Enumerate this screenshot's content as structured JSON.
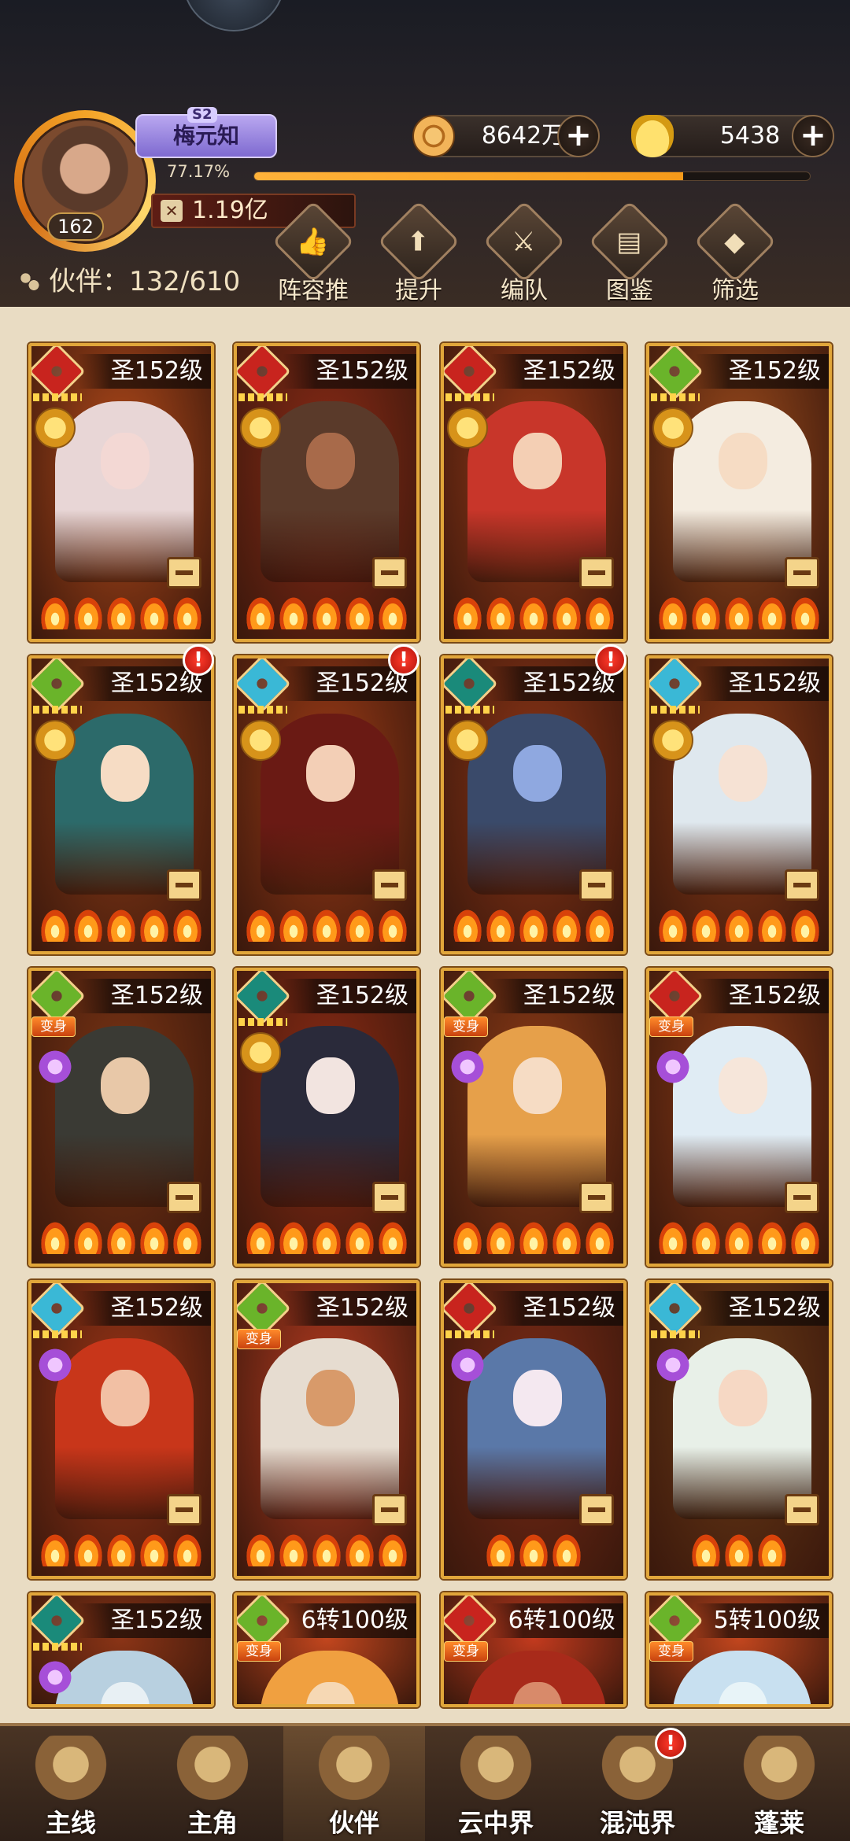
{
  "player": {
    "name": "梅元知",
    "server": "S2",
    "level": "162",
    "exp_percent_text": "77.17%",
    "exp_fraction": 0.7717,
    "power": "1.19亿",
    "power_icon": "crossed-swords-icon"
  },
  "currency": {
    "coins": "8642万",
    "gold": "5438"
  },
  "partners": {
    "label": "伙伴：132/610"
  },
  "toolbar": [
    {
      "label": "阵容推荐",
      "icon": "thumbs-up-icon"
    },
    {
      "label": "提升",
      "icon": "upgrade-arrow-icon"
    },
    {
      "label": "编队",
      "icon": "formation-icon"
    },
    {
      "label": "图鉴",
      "icon": "scroll-icon"
    },
    {
      "label": "筛选",
      "icon": "filter-icon"
    }
  ],
  "cards": [
    {
      "level": "圣152级",
      "element": "red",
      "sub": "gold",
      "stars": 5,
      "alert": false,
      "transform": "",
      "bg": "#b34a1a",
      "char": "#e8d6d6",
      "face": "#f3d8d4"
    },
    {
      "level": "圣152级",
      "element": "red",
      "sub": "gold",
      "stars": 5,
      "alert": false,
      "transform": "",
      "bg": "#8a2a16",
      "char": "#5a3a2a",
      "face": "#a86a4a"
    },
    {
      "level": "圣152级",
      "element": "red",
      "sub": "gold",
      "stars": 5,
      "alert": false,
      "transform": "",
      "bg": "#9a3a18",
      "char": "#c8362a",
      "face": "#f4cfb4"
    },
    {
      "level": "圣152级",
      "element": "green",
      "sub": "gold",
      "stars": 5,
      "alert": false,
      "transform": "",
      "bg": "#9a4a1c",
      "char": "#f4ece0",
      "face": "#f6dcc4"
    },
    {
      "level": "圣152级",
      "element": "green",
      "sub": "gold",
      "stars": 5,
      "alert": true,
      "transform": "",
      "bg": "#8a3a16",
      "char": "#2c6a6a",
      "face": "#f6dcc4"
    },
    {
      "level": "圣152级",
      "element": "cyan",
      "sub": "gold",
      "stars": 5,
      "alert": true,
      "transform": "",
      "bg": "#9a3a16",
      "char": "#6a1a14",
      "face": "#f3cfb6"
    },
    {
      "level": "圣152级",
      "element": "teal",
      "sub": "gold",
      "stars": 5,
      "alert": true,
      "transform": "",
      "bg": "#8a3416",
      "char": "#3a4a6a",
      "face": "#8fa8e0"
    },
    {
      "level": "圣152级",
      "element": "cyan",
      "sub": "gold",
      "stars": 5,
      "alert": false,
      "transform": "",
      "bg": "#8a3a16",
      "char": "#dfe8ee",
      "face": "#f6e2d4"
    },
    {
      "level": "圣152级",
      "element": "green",
      "sub": "purple",
      "stars": 5,
      "alert": false,
      "transform": "变身",
      "bg": "#7a3414",
      "char": "#3a3a34",
      "face": "#e8c8a8"
    },
    {
      "level": "圣152级",
      "element": "teal",
      "sub": "moon",
      "stars": 5,
      "alert": false,
      "transform": "",
      "bg": "#8a2a14",
      "char": "#2a2a3a",
      "face": "#f2e4e0"
    },
    {
      "level": "圣152级",
      "element": "green",
      "sub": "purple",
      "stars": 5,
      "alert": false,
      "transform": "变身",
      "bg": "#8a3a16",
      "char": "#e6a04a",
      "face": "#f6dcc4"
    },
    {
      "level": "圣152级",
      "element": "red",
      "sub": "purple",
      "stars": 5,
      "alert": false,
      "transform": "变身",
      "bg": "#8a3a16",
      "char": "#e0ecf4",
      "face": "#f6e6da"
    },
    {
      "level": "圣152级",
      "element": "cyan",
      "sub": "purple",
      "stars": 5,
      "alert": false,
      "transform": "",
      "bg": "#9a3416",
      "char": "#c8361a",
      "face": "#f2c0a4"
    },
    {
      "level": "圣152级",
      "element": "green",
      "sub": "none",
      "stars": 0,
      "alert": false,
      "transform": "变身",
      "bg": "#b43a20",
      "char": "#e6dcd0",
      "face": "#d89a6a"
    },
    {
      "level": "圣152级",
      "element": "red",
      "sub": "purple",
      "stars": 3,
      "alert": false,
      "transform": "",
      "bg": "#7a2a16",
      "char": "#5a78a8",
      "face": "#f4e8f0"
    },
    {
      "level": "圣152级",
      "element": "cyan",
      "sub": "purple",
      "stars": 3,
      "alert": false,
      "transform": "",
      "bg": "#6a3a16",
      "char": "#e8f0e8",
      "face": "#f6d8c4"
    },
    {
      "level": "圣152级",
      "element": "teal",
      "sub": "purple",
      "stars": 0,
      "alert": false,
      "transform": "",
      "bg": "#8a3416",
      "char": "#b8d0e0",
      "face": "#e8f0f4"
    },
    {
      "level": "6转100级",
      "element": "green",
      "sub": "none",
      "stars": 0,
      "alert": false,
      "transform": "变身",
      "bg": "#c2461e",
      "char": "#f0a040",
      "face": "#f6d8b4"
    },
    {
      "level": "6转100级",
      "element": "red",
      "sub": "none",
      "stars": 0,
      "alert": false,
      "transform": "变身",
      "bg": "#c23a1e",
      "char": "#a82a1a",
      "face": "#d88a6a"
    },
    {
      "level": "5转100级",
      "element": "green",
      "sub": "none",
      "stars": 0,
      "alert": false,
      "transform": "变身",
      "bg": "#c2461e",
      "char": "#c8e0f0",
      "face": "#e8f4f8"
    }
  ],
  "nav": [
    {
      "label": "主线",
      "icon": "crossed-swords-icon",
      "active": false,
      "alert": false
    },
    {
      "label": "主角",
      "icon": "hero-icon",
      "active": false,
      "alert": false
    },
    {
      "label": "伙伴",
      "icon": "partner-crown-icon",
      "active": true,
      "alert": false
    },
    {
      "label": "云中界",
      "icon": "cloud-pagoda-icon",
      "active": false,
      "alert": false
    },
    {
      "label": "混沌界",
      "icon": "chaos-tower-icon",
      "active": false,
      "alert": true
    },
    {
      "label": "蓬莱",
      "icon": "penglai-sage-icon",
      "active": false,
      "alert": false
    }
  ],
  "colors": {
    "element_red": "#c8241e",
    "element_green": "#6ab42a",
    "element_cyan": "#3ab8d6",
    "element_teal": "#1a8a7a",
    "accent_gold": "#e1a63a",
    "exp_orange": "#f59a1a"
  }
}
